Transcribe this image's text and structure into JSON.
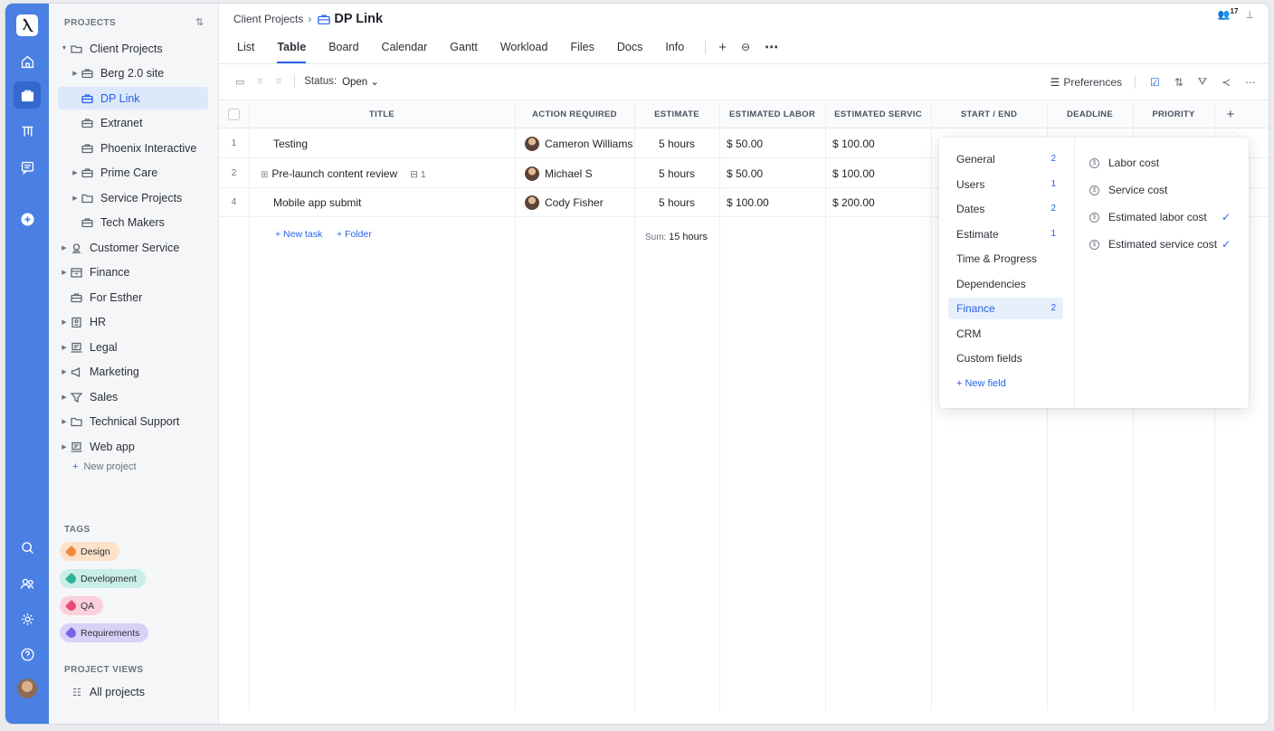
{
  "rail": {
    "logo_glyph": "Ⲗ"
  },
  "sidebar": {
    "projects_header": "PROJECTS",
    "sort_glyph": "⇅",
    "items": [
      {
        "label": "Client Projects",
        "caret": "▼",
        "icon": "folder-open-icon"
      },
      {
        "label": "Berg 2.0 site",
        "caret": "▶",
        "icon": "briefcase-icon"
      },
      {
        "label": "DP Link",
        "caret": "",
        "icon": "briefcase-icon"
      },
      {
        "label": "Extranet",
        "caret": "",
        "icon": "briefcase-icon"
      },
      {
        "label": "Phoenix Interactive",
        "caret": "",
        "icon": "briefcase-icon"
      },
      {
        "label": "Prime Care",
        "caret": "▶",
        "icon": "briefcase-icon"
      },
      {
        "label": "Service Projects",
        "caret": "▶",
        "icon": "folder-icon"
      },
      {
        "label": "Tech Makers",
        "caret": "",
        "icon": "briefcase-icon"
      },
      {
        "label": "Customer Service",
        "caret": "▶",
        "icon": "headset-icon"
      },
      {
        "label": "Finance",
        "caret": "▶",
        "icon": "archive-icon"
      },
      {
        "label": "For Esther",
        "caret": "",
        "icon": "briefcase-icon"
      },
      {
        "label": "HR",
        "caret": "▶",
        "icon": "id-card-icon"
      },
      {
        "label": "Legal",
        "caret": "▶",
        "icon": "laptop-icon"
      },
      {
        "label": "Marketing",
        "caret": "▶",
        "icon": "megaphone-icon"
      },
      {
        "label": "Sales",
        "caret": "▶",
        "icon": "funnel-icon"
      },
      {
        "label": "Technical Support",
        "caret": "▶",
        "icon": "folder-icon"
      },
      {
        "label": "Web app",
        "caret": "▶",
        "icon": "laptop-icon"
      }
    ],
    "new_project_plus": "+",
    "new_project": "New project",
    "tags_header": "TAGS",
    "tags": [
      {
        "label": "Design",
        "bg": "#fde1c8",
        "color": "#f08a3c"
      },
      {
        "label": "Development",
        "bg": "#c9eee6",
        "color": "#2bb39b"
      },
      {
        "label": "QA",
        "bg": "#fbd0dc",
        "color": "#e84a74"
      },
      {
        "label": "Requirements",
        "bg": "#d9d2f7",
        "color": "#7d63e6"
      }
    ],
    "project_views_header": "PROJECT VIEWS",
    "all_projects": "All projects"
  },
  "header": {
    "breadcrumb_parent": "Client Projects",
    "breadcrumb_sep": "›",
    "title": "DP Link",
    "members_count": "17"
  },
  "tabs": [
    "List",
    "Table",
    "Board",
    "Calendar",
    "Gantt",
    "Workload",
    "Files",
    "Docs",
    "Info"
  ],
  "toolbar": {
    "status_label": "Status:",
    "status_value": "Open ⌄",
    "preferences": "Preferences"
  },
  "table": {
    "columns": [
      "TITLE",
      "ACTION REQUIRED",
      "ESTIMATE",
      "ESTIMATED LABOR",
      "ESTIMATED SERVIC",
      "START / END",
      "DEADLINE",
      "PRIORITY"
    ],
    "rows": [
      {
        "num": "1",
        "title": "Testing",
        "subtasks": "",
        "assignee": "Cameron Williams",
        "estimate": "5 hours",
        "labor": "$ 50.00",
        "service": "$ 100.00"
      },
      {
        "num": "2",
        "title": "Pre-launch content review",
        "subtasks": "1",
        "assignee": "Michael S",
        "estimate": "5 hours",
        "labor": "$ 50.00",
        "service": "$ 100.00"
      },
      {
        "num": "4",
        "title": "Mobile app submit",
        "subtasks": "",
        "assignee": "Cody Fisher",
        "estimate": "5 hours",
        "labor": "$ 100.00",
        "service": "$ 200.00"
      }
    ],
    "new_task": "+ New task",
    "new_folder": "+ Folder",
    "sum_label": "Sum:",
    "sum_value": "15 hours"
  },
  "popover": {
    "categories": [
      {
        "label": "General",
        "count": "2"
      },
      {
        "label": "Users",
        "count": "1"
      },
      {
        "label": "Dates",
        "count": "2"
      },
      {
        "label": "Estimate",
        "count": "1"
      },
      {
        "label": "Time & Progress",
        "count": ""
      },
      {
        "label": "Dependencies",
        "count": ""
      },
      {
        "label": "Finance",
        "count": "2"
      },
      {
        "label": "CRM",
        "count": ""
      },
      {
        "label": "Custom fields",
        "count": ""
      }
    ],
    "new_field": "+  New field",
    "fields": [
      {
        "label": "Labor cost",
        "checked": false
      },
      {
        "label": "Service cost",
        "checked": false
      },
      {
        "label": "Estimated labor cost",
        "checked": true
      },
      {
        "label": "Estimated service cost",
        "checked": true
      }
    ]
  }
}
